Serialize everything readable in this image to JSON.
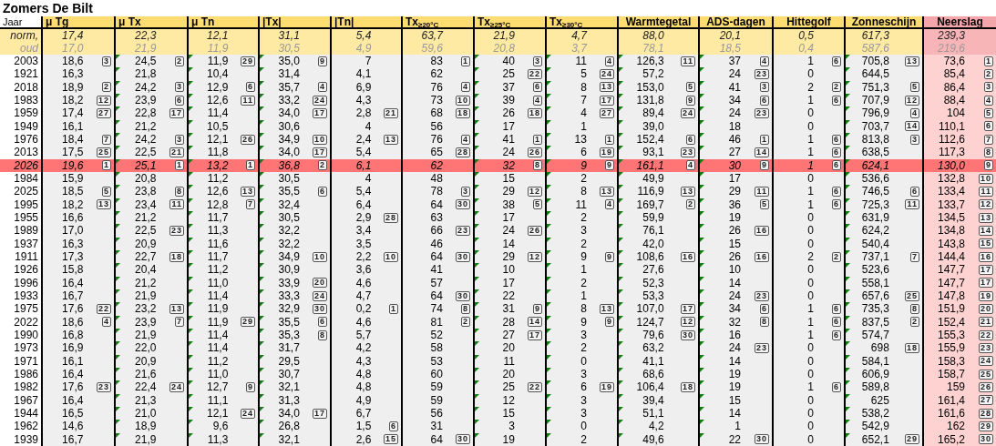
{
  "title": "Zomers De Bilt",
  "year_header": "Jaar",
  "columns": [
    {
      "label": "μ Tg",
      "marked": false,
      "emphasized": false
    },
    {
      "label": "μ Tx",
      "marked": true,
      "emphasized": false
    },
    {
      "label": "μ Tn",
      "marked": true,
      "emphasized": false
    },
    {
      "label": "|Tx|",
      "marked": true,
      "emphasized": false
    },
    {
      "label": "|Tn|",
      "marked": false,
      "emphasized": false
    },
    {
      "label": "Tx$_{≥20°C}$",
      "marked": false,
      "emphasized": false
    },
    {
      "label": "Tx$_{≥25°C}$",
      "marked": true,
      "emphasized": false
    },
    {
      "label": "Tx$_{≥30°C}$",
      "marked": true,
      "emphasized": false
    },
    {
      "label": "Warmtegetal",
      "marked": true,
      "emphasized": false
    },
    {
      "label": "ADS-dagen",
      "marked": true,
      "emphasized": false
    },
    {
      "label": "Hittegolf",
      "marked": false,
      "emphasized": false
    },
    {
      "label": "Zonneschijn",
      "marked": true,
      "emphasized": false
    },
    {
      "label": "Neerslag",
      "marked": false,
      "emphasized": true
    }
  ],
  "reference_rows": [
    {
      "label": "norm,",
      "kind": "norm",
      "values": [
        "17,4",
        "22,3",
        "12,1",
        "31,1",
        "5,4",
        "63,7",
        "21,9",
        "4,7",
        "88,0",
        "20,1",
        "0,5",
        "617,3",
        "239,3"
      ]
    },
    {
      "label": "oud",
      "kind": "old",
      "values": [
        "17,0",
        "21,9",
        "11,9",
        "30,5",
        "4,9",
        "59,6",
        "20,8",
        "3,7",
        "78,1",
        "18,5",
        "0,4",
        "587,6",
        "219,6"
      ]
    }
  ],
  "rows": [
    {
      "year": "2003",
      "highlighted": false,
      "cells": [
        [
          "18,6",
          "3"
        ],
        [
          "24,5",
          "2"
        ],
        [
          "11,9",
          "29"
        ],
        [
          "35,0",
          "9"
        ],
        [
          "7"
        ],
        [
          "83",
          "1"
        ],
        [
          "40",
          "3"
        ],
        [
          "11",
          "4"
        ],
        [
          "126,3",
          "11"
        ],
        [
          "37",
          "4"
        ],
        [
          "1",
          "6"
        ],
        [
          "705,8",
          "13"
        ],
        [
          "73,6",
          "1"
        ]
      ]
    },
    {
      "year": "1921",
      "highlighted": false,
      "cells": [
        [
          "16,3"
        ],
        [
          "21,8"
        ],
        [
          "10,4"
        ],
        [
          "31,4"
        ],
        [
          "4,1"
        ],
        [
          "62"
        ],
        [
          "25",
          "22"
        ],
        [
          "5",
          "24"
        ],
        [
          "57,2"
        ],
        [
          "24",
          "23"
        ],
        [
          "0"
        ],
        [
          "644,5"
        ],
        [
          "85,4",
          "2"
        ]
      ]
    },
    {
      "year": "2018",
      "highlighted": false,
      "cells": [
        [
          "18,9",
          "2"
        ],
        [
          "24,2",
          "3"
        ],
        [
          "12,9",
          "6"
        ],
        [
          "35,7",
          "4"
        ],
        [
          "6,9"
        ],
        [
          "76",
          "4"
        ],
        [
          "37",
          "6"
        ],
        [
          "8",
          "13"
        ],
        [
          "153,0",
          "5"
        ],
        [
          "41",
          "3"
        ],
        [
          "2",
          "2"
        ],
        [
          "751,3",
          "5"
        ],
        [
          "86,4",
          "3"
        ]
      ]
    },
    {
      "year": "1983",
      "highlighted": false,
      "cells": [
        [
          "18,2",
          "12"
        ],
        [
          "23,9",
          "6"
        ],
        [
          "12,6",
          "11"
        ],
        [
          "33,2",
          "24"
        ],
        [
          "4,3"
        ],
        [
          "73",
          "10"
        ],
        [
          "39",
          "4"
        ],
        [
          "7",
          "17"
        ],
        [
          "131,8",
          "9"
        ],
        [
          "34",
          "6"
        ],
        [
          "1",
          "6"
        ],
        [
          "707,9",
          "12"
        ],
        [
          "88,4",
          "4"
        ]
      ]
    },
    {
      "year": "1959",
      "highlighted": false,
      "cells": [
        [
          "17,4",
          "27"
        ],
        [
          "22,8",
          "17"
        ],
        [
          "11,4"
        ],
        [
          "34,0",
          "17"
        ],
        [
          "2,8",
          "21"
        ],
        [
          "68",
          "18"
        ],
        [
          "26",
          "18"
        ],
        [
          "4",
          "27"
        ],
        [
          "89,4",
          "24"
        ],
        [
          "24",
          "23"
        ],
        [
          "0"
        ],
        [
          "796,9",
          "4"
        ],
        [
          "104",
          "5"
        ]
      ]
    },
    {
      "year": "1949",
      "highlighted": false,
      "cells": [
        [
          "16,1"
        ],
        [
          "21,2"
        ],
        [
          "10,5"
        ],
        [
          "30,6"
        ],
        [
          "4"
        ],
        [
          "56"
        ],
        [
          "17"
        ],
        [
          "1"
        ],
        [
          "39,0"
        ],
        [
          "18"
        ],
        [
          "0"
        ],
        [
          "703,7",
          "14"
        ],
        [
          "110,1",
          "6"
        ]
      ]
    },
    {
      "year": "1976",
      "highlighted": false,
      "cells": [
        [
          "18,4",
          "7"
        ],
        [
          "24,2",
          "3"
        ],
        [
          "12,1",
          "26"
        ],
        [
          "34,9",
          "10"
        ],
        [
          "2,4",
          "13"
        ],
        [
          "76",
          "4"
        ],
        [
          "41",
          "1"
        ],
        [
          "13",
          "1"
        ],
        [
          "152,4",
          "6"
        ],
        [
          "46",
          "1"
        ],
        [
          "1",
          "6"
        ],
        [
          "813,8",
          "3"
        ],
        [
          "112,6",
          "7"
        ]
      ]
    },
    {
      "year": "2013",
      "highlighted": false,
      "cells": [
        [
          "17,5",
          "25"
        ],
        [
          "22,5",
          "21"
        ],
        [
          "11,8"
        ],
        [
          "34,0",
          "17"
        ],
        [
          "5,4"
        ],
        [
          "65",
          "28"
        ],
        [
          "24",
          "26"
        ],
        [
          "6",
          "19"
        ],
        [
          "93,1",
          "23"
        ],
        [
          "27",
          "14"
        ],
        [
          "1",
          "6"
        ],
        [
          "638,5"
        ],
        [
          "117,3",
          "8"
        ]
      ]
    },
    {
      "year": "2026",
      "highlighted": true,
      "cells": [
        [
          "19,6",
          "1"
        ],
        [
          "25,1",
          "1"
        ],
        [
          "13,2",
          "1"
        ],
        [
          "36,8",
          "2"
        ],
        [
          "6,1"
        ],
        [
          "62"
        ],
        [
          "32",
          "8"
        ],
        [
          "9",
          "9"
        ],
        [
          "161,1",
          "4"
        ],
        [
          "30",
          "9"
        ],
        [
          "1",
          "6"
        ],
        [
          "624,1"
        ],
        [
          "130,0",
          "9"
        ]
      ]
    },
    {
      "year": "1984",
      "highlighted": false,
      "cells": [
        [
          "15,9"
        ],
        [
          "20,8"
        ],
        [
          "11,2"
        ],
        [
          "30,5"
        ],
        [
          "4"
        ],
        [
          "48"
        ],
        [
          "15"
        ],
        [
          "2"
        ],
        [
          "49,9"
        ],
        [
          "17"
        ],
        [
          "0"
        ],
        [
          "536,6"
        ],
        [
          "132,8",
          "10"
        ]
      ]
    },
    {
      "year": "2025",
      "highlighted": false,
      "cells": [
        [
          "18,5",
          "5"
        ],
        [
          "23,8",
          "8"
        ],
        [
          "12,6",
          "13"
        ],
        [
          "35,5",
          "6"
        ],
        [
          "5,4"
        ],
        [
          "78",
          "3"
        ],
        [
          "29",
          "12"
        ],
        [
          "8",
          "13"
        ],
        [
          "116,9",
          "13"
        ],
        [
          "29",
          "11"
        ],
        [
          "1",
          "6"
        ],
        [
          "746,5",
          "6"
        ],
        [
          "133,4",
          "11"
        ]
      ]
    },
    {
      "year": "1995",
      "highlighted": false,
      "cells": [
        [
          "18,2",
          "13"
        ],
        [
          "23,4",
          "11"
        ],
        [
          "12,8",
          "7"
        ],
        [
          "32,4"
        ],
        [
          "6,4"
        ],
        [
          "64",
          "30"
        ],
        [
          "38",
          "5"
        ],
        [
          "11",
          "4"
        ],
        [
          "169,7",
          "2"
        ],
        [
          "36",
          "5"
        ],
        [
          "1",
          "6"
        ],
        [
          "725,3",
          "11"
        ],
        [
          "133,7",
          "12"
        ]
      ]
    },
    {
      "year": "1955",
      "highlighted": false,
      "cells": [
        [
          "16,6"
        ],
        [
          "21,2"
        ],
        [
          "11,7"
        ],
        [
          "30,5"
        ],
        [
          "2,9",
          "28"
        ],
        [
          "63"
        ],
        [
          "17"
        ],
        [
          "2"
        ],
        [
          "59,9"
        ],
        [
          "19"
        ],
        [
          "0"
        ],
        [
          "631,9"
        ],
        [
          "134,5",
          "13"
        ]
      ]
    },
    {
      "year": "1989",
      "highlighted": false,
      "cells": [
        [
          "17,0"
        ],
        [
          "22,5",
          "23"
        ],
        [
          "11,3"
        ],
        [
          "32,2"
        ],
        [
          "3,4"
        ],
        [
          "66",
          "23"
        ],
        [
          "24",
          "26"
        ],
        [
          "3"
        ],
        [
          "76,1"
        ],
        [
          "26",
          "16"
        ],
        [
          "0"
        ],
        [
          "624,2"
        ],
        [
          "134,8",
          "14"
        ]
      ]
    },
    {
      "year": "1937",
      "highlighted": false,
      "cells": [
        [
          "16,3"
        ],
        [
          "20,9"
        ],
        [
          "11,6"
        ],
        [
          "32,2"
        ],
        [
          "3,5"
        ],
        [
          "46"
        ],
        [
          "14"
        ],
        [
          "2"
        ],
        [
          "42,0"
        ],
        [
          "15"
        ],
        [
          "0"
        ],
        [
          "540,4"
        ],
        [
          "143,8",
          "15"
        ]
      ]
    },
    {
      "year": "1911",
      "highlighted": false,
      "cells": [
        [
          "17,3"
        ],
        [
          "22,7",
          "18"
        ],
        [
          "11,7"
        ],
        [
          "34,9",
          "10"
        ],
        [
          "2,2",
          "10"
        ],
        [
          "64",
          "30"
        ],
        [
          "29",
          "12"
        ],
        [
          "9",
          "9"
        ],
        [
          "108,6",
          "16"
        ],
        [
          "26",
          "16"
        ],
        [
          "2",
          "2"
        ],
        [
          "737,1",
          "7"
        ],
        [
          "144,4",
          "16"
        ]
      ]
    },
    {
      "year": "1926",
      "highlighted": false,
      "cells": [
        [
          "15,8"
        ],
        [
          "20,4"
        ],
        [
          "11,2"
        ],
        [
          "30,9"
        ],
        [
          "3,6"
        ],
        [
          "41"
        ],
        [
          "10"
        ],
        [
          "1"
        ],
        [
          "27,6"
        ],
        [
          "10"
        ],
        [
          "0"
        ],
        [
          "523,6"
        ],
        [
          "147,7",
          "17"
        ]
      ]
    },
    {
      "year": "1996",
      "highlighted": false,
      "cells": [
        [
          "16,4"
        ],
        [
          "21,2"
        ],
        [
          "11,0"
        ],
        [
          "33,9",
          "20"
        ],
        [
          "4,6"
        ],
        [
          "57"
        ],
        [
          "17"
        ],
        [
          "2"
        ],
        [
          "52,3"
        ],
        [
          "14"
        ],
        [
          "0"
        ],
        [
          "558,1"
        ],
        [
          "147,7",
          "17"
        ]
      ]
    },
    {
      "year": "1933",
      "highlighted": false,
      "cells": [
        [
          "16,7"
        ],
        [
          "21,9"
        ],
        [
          "11,4"
        ],
        [
          "33,3",
          "24"
        ],
        [
          "4,7"
        ],
        [
          "64",
          "30"
        ],
        [
          "22"
        ],
        [
          "1"
        ],
        [
          "53,3"
        ],
        [
          "24",
          "23"
        ],
        [
          "0"
        ],
        [
          "657,6",
          "25"
        ],
        [
          "147,8",
          "19"
        ]
      ]
    },
    {
      "year": "1975",
      "highlighted": false,
      "cells": [
        [
          "17,6",
          "22"
        ],
        [
          "23,2",
          "13"
        ],
        [
          "11,9"
        ],
        [
          "32,9",
          "30"
        ],
        [
          "0,2",
          "1"
        ],
        [
          "74",
          "8"
        ],
        [
          "31",
          "9"
        ],
        [
          "8",
          "13"
        ],
        [
          "107,0",
          "17"
        ],
        [
          "34",
          "6"
        ],
        [
          "1",
          "6"
        ],
        [
          "735,3",
          "8"
        ],
        [
          "151,9",
          "20"
        ]
      ]
    },
    {
      "year": "2022",
      "highlighted": false,
      "cells": [
        [
          "18,6",
          "4"
        ],
        [
          "23,9",
          "7"
        ],
        [
          "11,9",
          "29"
        ],
        [
          "35,5",
          "6"
        ],
        [
          "4,6"
        ],
        [
          "81",
          "2"
        ],
        [
          "28",
          "14"
        ],
        [
          "9",
          "9"
        ],
        [
          "124,7",
          "12"
        ],
        [
          "32",
          "8"
        ],
        [
          "1",
          "6"
        ],
        [
          "837,5",
          "2"
        ],
        [
          "152,4",
          "21"
        ]
      ]
    },
    {
      "year": "1990",
      "highlighted": false,
      "cells": [
        [
          "16,8"
        ],
        [
          "21,9"
        ],
        [
          "11,4"
        ],
        [
          "35,3",
          "8"
        ],
        [
          "5,7"
        ],
        [
          "52"
        ],
        [
          "27",
          "17"
        ],
        [
          "3"
        ],
        [
          "79,6",
          "30"
        ],
        [
          "16"
        ],
        [
          "1",
          "6"
        ],
        [
          "574,7"
        ],
        [
          "155,3",
          "22"
        ]
      ]
    },
    {
      "year": "1973",
      "highlighted": false,
      "cells": [
        [
          "16,9"
        ],
        [
          "22,0"
        ],
        [
          "11,4"
        ],
        [
          "31,7"
        ],
        [
          "4,2"
        ],
        [
          "58"
        ],
        [
          "20"
        ],
        [
          "2"
        ],
        [
          "63,2"
        ],
        [
          "24",
          "23"
        ],
        [
          "0"
        ],
        [
          "698",
          "18"
        ],
        [
          "155,9",
          "23"
        ]
      ]
    },
    {
      "year": "1971",
      "highlighted": false,
      "cells": [
        [
          "16,1"
        ],
        [
          "20,9"
        ],
        [
          "11,2"
        ],
        [
          "29,5"
        ],
        [
          "4,3"
        ],
        [
          "53"
        ],
        [
          "11"
        ],
        [
          "0"
        ],
        [
          "41,1"
        ],
        [
          "14"
        ],
        [
          "0"
        ],
        [
          "584,1"
        ],
        [
          "158,3",
          "24"
        ]
      ]
    },
    {
      "year": "1986",
      "highlighted": false,
      "cells": [
        [
          "16,4"
        ],
        [
          "21,6"
        ],
        [
          "11,0"
        ],
        [
          "30,7"
        ],
        [
          "4,8"
        ],
        [
          "60"
        ],
        [
          "20"
        ],
        [
          "3"
        ],
        [
          "68,6"
        ],
        [
          "19"
        ],
        [
          "0"
        ],
        [
          "606,9"
        ],
        [
          "158,7",
          "25"
        ]
      ]
    },
    {
      "year": "1982",
      "highlighted": false,
      "cells": [
        [
          "17,6",
          "23"
        ],
        [
          "22,4",
          "24"
        ],
        [
          "12,7",
          "9"
        ],
        [
          "32,1"
        ],
        [
          "4,8"
        ],
        [
          "59"
        ],
        [
          "25",
          "22"
        ],
        [
          "6",
          "19"
        ],
        [
          "106,4",
          "18"
        ],
        [
          "19"
        ],
        [
          "1",
          "6"
        ],
        [
          "589,8"
        ],
        [
          "159",
          "26"
        ]
      ]
    },
    {
      "year": "1967",
      "highlighted": false,
      "cells": [
        [
          "16,4"
        ],
        [
          "21,3"
        ],
        [
          "11,1"
        ],
        [
          "31,3"
        ],
        [
          "4,9"
        ],
        [
          "59"
        ],
        [
          "12"
        ],
        [
          "3"
        ],
        [
          "39,4"
        ],
        [
          "15"
        ],
        [
          "0"
        ],
        [
          "625"
        ],
        [
          "161,4",
          "27"
        ]
      ]
    },
    {
      "year": "1944",
      "highlighted": false,
      "cells": [
        [
          "16,5"
        ],
        [
          "21,0"
        ],
        [
          "12,1",
          "24"
        ],
        [
          "34,0",
          "17"
        ],
        [
          "6,7"
        ],
        [
          "56"
        ],
        [
          "15"
        ],
        [
          "3"
        ],
        [
          "51,1"
        ],
        [
          "14"
        ],
        [
          "0"
        ],
        [
          "538,2"
        ],
        [
          "161,6",
          "28"
        ]
      ]
    },
    {
      "year": "1962",
      "highlighted": false,
      "cells": [
        [
          "14,6"
        ],
        [
          "18,9"
        ],
        [
          "9,6"
        ],
        [
          "26,8"
        ],
        [
          "1,5",
          "6"
        ],
        [
          "31"
        ],
        [
          "3"
        ],
        [
          "0"
        ],
        [
          "4,2"
        ],
        [
          "1"
        ],
        [
          "0"
        ],
        [
          "542,9"
        ],
        [
          "162",
          "29"
        ]
      ]
    },
    {
      "year": "1939",
      "highlighted": false,
      "cells": [
        [
          "16,7"
        ],
        [
          "21,9"
        ],
        [
          "11,3"
        ],
        [
          "32,1"
        ],
        [
          "2,6",
          "15"
        ],
        [
          "64",
          "30"
        ],
        [
          "19"
        ],
        [
          "2"
        ],
        [
          "49,6"
        ],
        [
          "22",
          "30"
        ],
        [
          "0"
        ],
        [
          "652,1",
          "29"
        ],
        [
          "165,2",
          "30"
        ]
      ]
    }
  ]
}
